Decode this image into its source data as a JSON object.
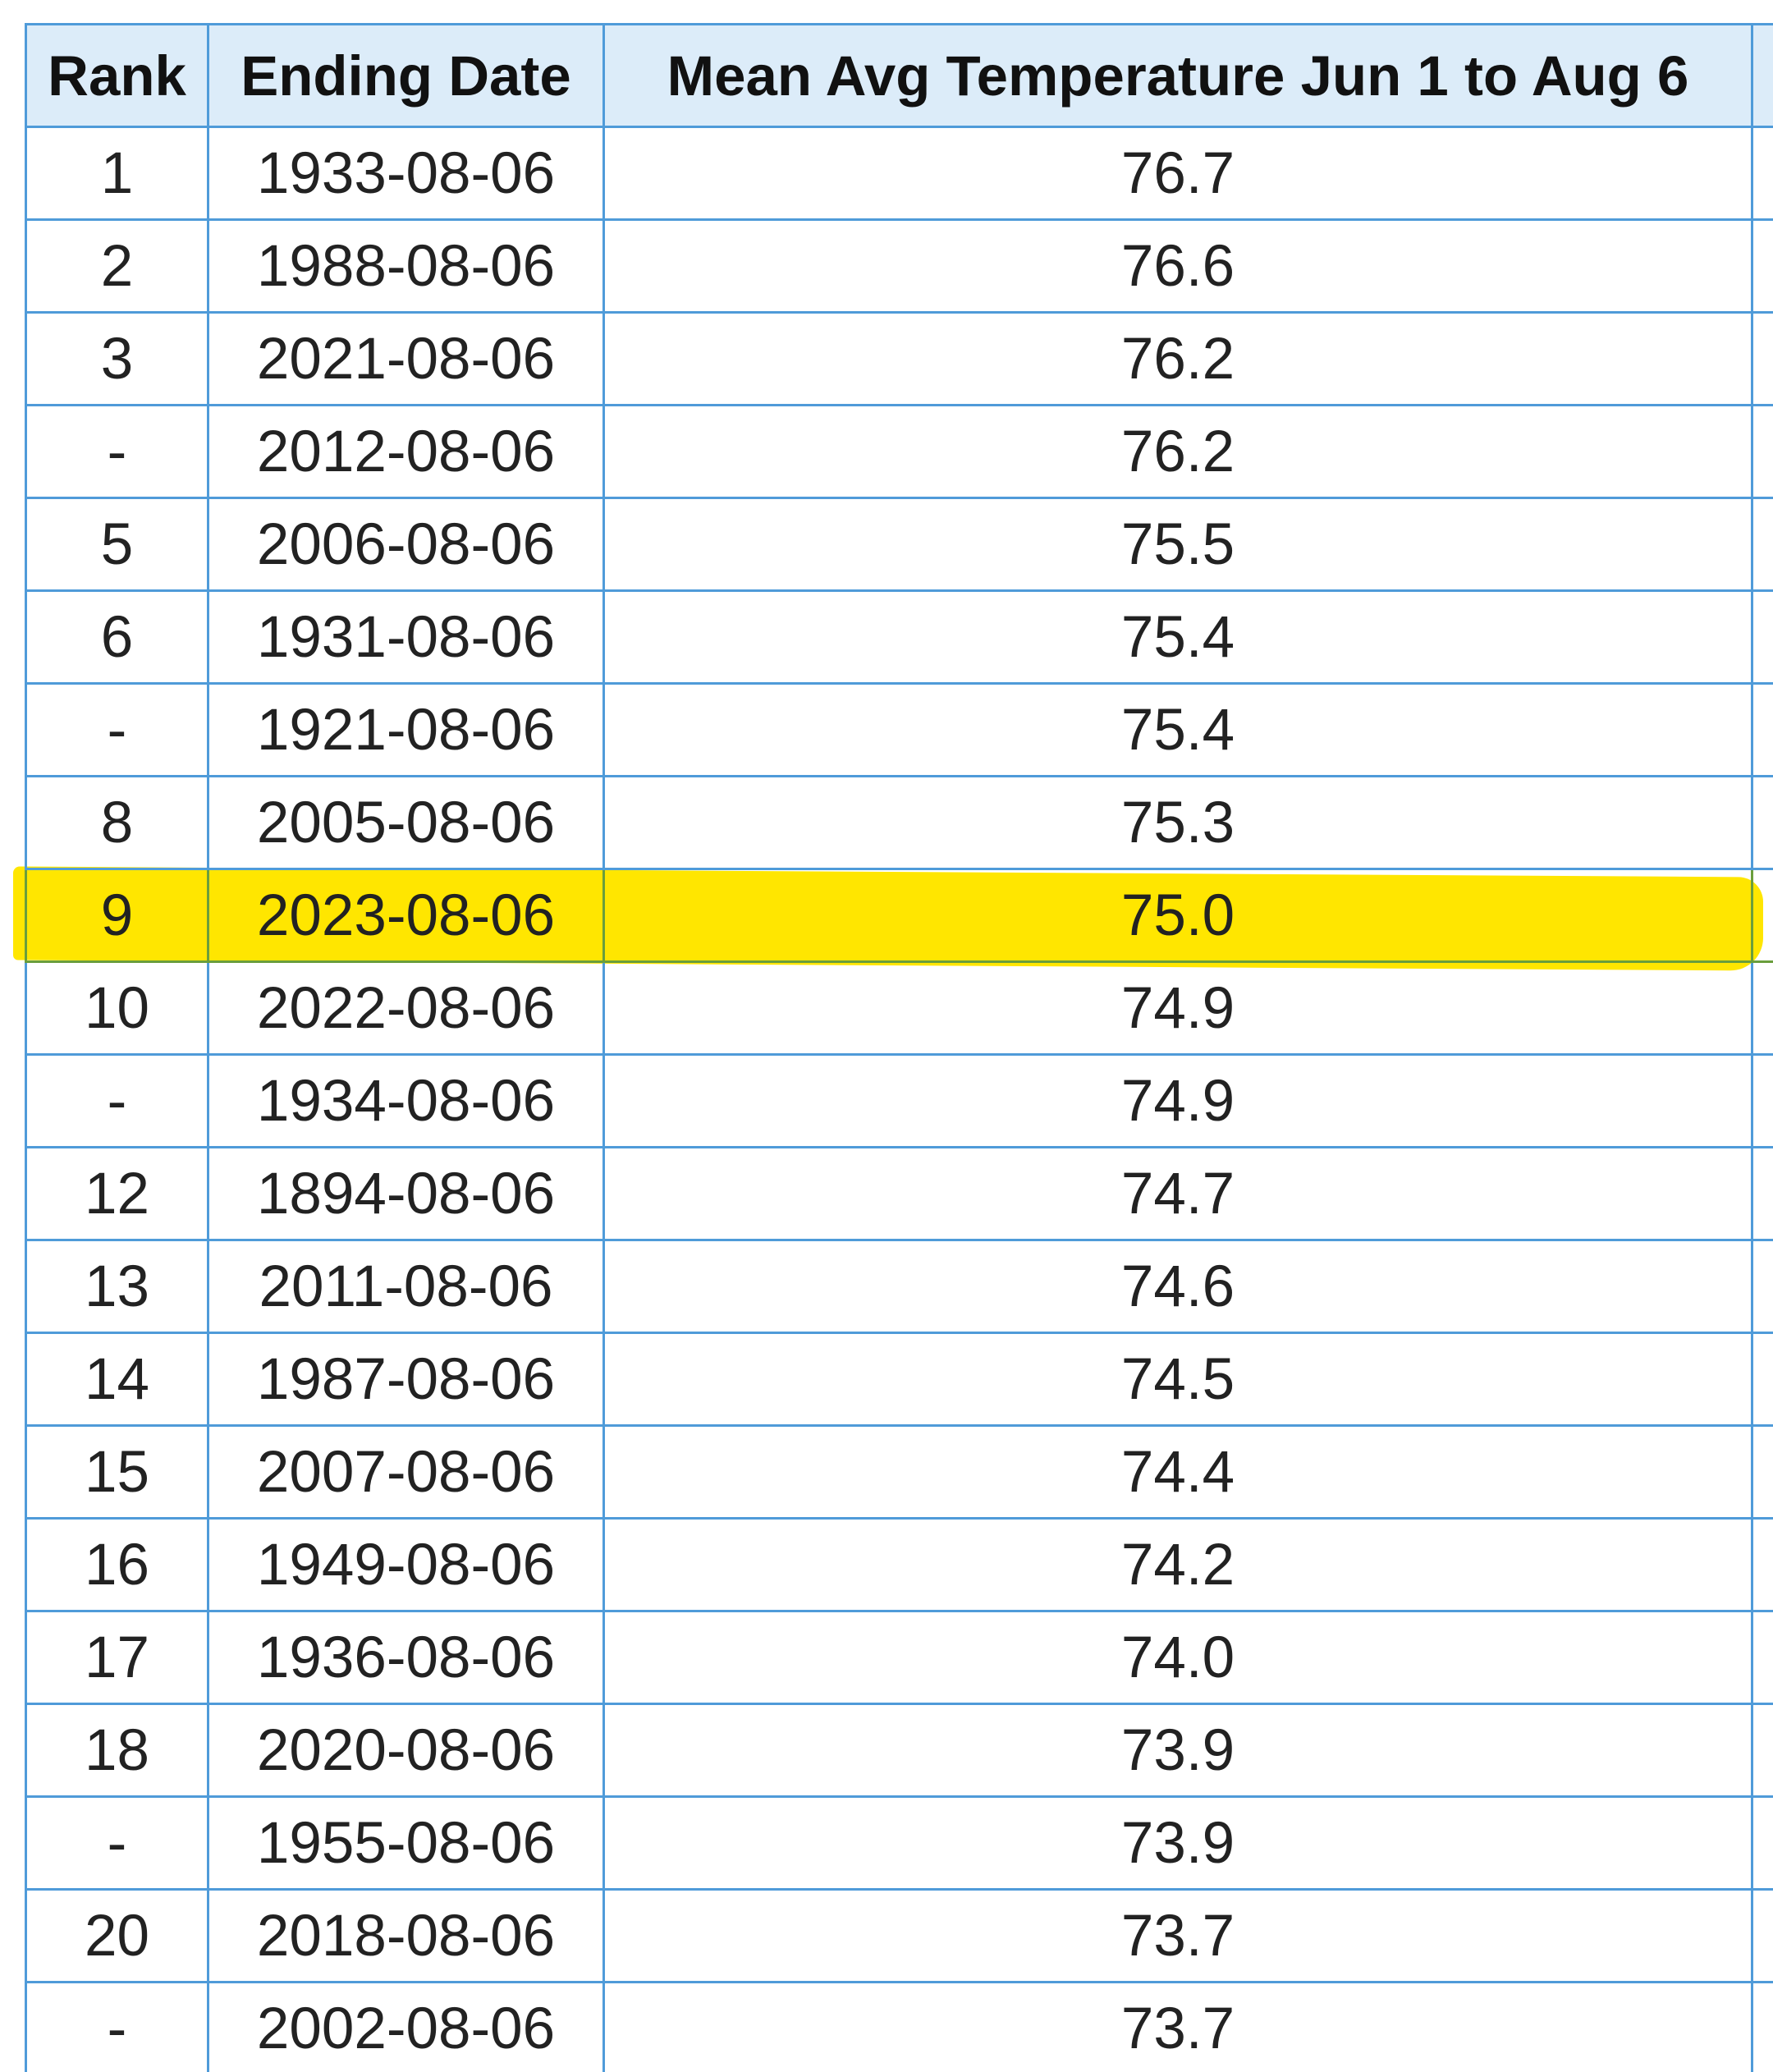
{
  "table": {
    "headers": {
      "rank": "Rank",
      "date": "Ending Date",
      "temp": "Mean Avg Temperature Jun 1 to Aug 6"
    },
    "highlight_color": "#ffe600",
    "border_color": "#4f9bd9",
    "header_background": "#dcecf9",
    "rows": [
      {
        "rank": "1",
        "date": "1933-08-06",
        "temp": "76.7"
      },
      {
        "rank": "2",
        "date": "1988-08-06",
        "temp": "76.6"
      },
      {
        "rank": "3",
        "date": "2021-08-06",
        "temp": "76.2"
      },
      {
        "rank": "-",
        "date": "2012-08-06",
        "temp": "76.2"
      },
      {
        "rank": "5",
        "date": "2006-08-06",
        "temp": "75.5"
      },
      {
        "rank": "6",
        "date": "1931-08-06",
        "temp": "75.4"
      },
      {
        "rank": "-",
        "date": "1921-08-06",
        "temp": "75.4"
      },
      {
        "rank": "8",
        "date": "2005-08-06",
        "temp": "75.3"
      },
      {
        "rank": "9",
        "date": "2023-08-06",
        "temp": "75.0",
        "highlighted": true
      },
      {
        "rank": "10",
        "date": "2022-08-06",
        "temp": "74.9"
      },
      {
        "rank": "-",
        "date": "1934-08-06",
        "temp": "74.9"
      },
      {
        "rank": "12",
        "date": "1894-08-06",
        "temp": "74.7"
      },
      {
        "rank": "13",
        "date": "2011-08-06",
        "temp": "74.6"
      },
      {
        "rank": "14",
        "date": "1987-08-06",
        "temp": "74.5"
      },
      {
        "rank": "15",
        "date": "2007-08-06",
        "temp": "74.4"
      },
      {
        "rank": "16",
        "date": "1949-08-06",
        "temp": "74.2"
      },
      {
        "rank": "17",
        "date": "1936-08-06",
        "temp": "74.0"
      },
      {
        "rank": "18",
        "date": "2020-08-06",
        "temp": "73.9"
      },
      {
        "rank": "-",
        "date": "1955-08-06",
        "temp": "73.9"
      },
      {
        "rank": "20",
        "date": "2018-08-06",
        "temp": "73.7"
      },
      {
        "rank": "-",
        "date": "2002-08-06",
        "temp": "73.7"
      }
    ]
  }
}
